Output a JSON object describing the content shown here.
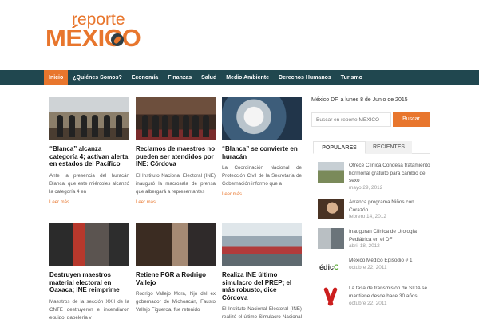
{
  "logo": {
    "top": "reporte",
    "main": "MÉXICO"
  },
  "nav": {
    "items": [
      {
        "label": "Inicio",
        "active": true
      },
      {
        "label": "¿Quiénes Somos?"
      },
      {
        "label": "Economía"
      },
      {
        "label": "Finanzas"
      },
      {
        "label": "Salud"
      },
      {
        "label": "Medio Ambiente"
      },
      {
        "label": "Derechos Humanos"
      },
      {
        "label": "Turismo"
      }
    ]
  },
  "articles": [
    {
      "title": "“Blanca” alcanza categoría 4; activan alerta en estados del Pacífico",
      "excerpt": "Ante la presencia del huracán Blanca, que este miércoles alcanzó la categoría 4 en",
      "more": "Leer más"
    },
    {
      "title": "Reclamos de maestros no pueden ser atendidos por INE: Córdova",
      "excerpt": "El Instituto Nacional Electoral (INE) inauguró la macrosala de prensa que albergará a representantes",
      "more": "Leer más"
    },
    {
      "title": "“Blanca” se convierte en huracán",
      "excerpt": "La Coordinación Nacional de Protección Civil de la Secretaría de Gobernación informó que a",
      "more": "Leer más"
    },
    {
      "title": "Destruyen maestros material electoral en Oaxaca; INE reimprime",
      "excerpt": "Maestros de la sección XXII de la CNTE destruyeron e incendiaron equipo, papelería y"
    },
    {
      "title": "Retiene PGR a Rodrigo Vallejo",
      "excerpt": "Rodrigo Vallejo Mora, hijo del ex gobernador de Michoacán, Fausto Vallejo Figueroa, fue retenido"
    },
    {
      "title": "Realiza INE último simulacro del PREP; el más robusto, dice Córdova",
      "excerpt": "El Instituto Nacional Electoral (INE) realizó el último Simulacro Nacional del Programa de"
    }
  ],
  "sidebar": {
    "date": "México DF, a lunes 8 de Junio de 2015",
    "search_placeholder": "Buscar en reporte MÉXICO",
    "search_button": "Buscar",
    "tabs": [
      "POPULARES",
      "RECIENTES"
    ],
    "popular": [
      {
        "title": "Ofrece Clínica Condesa tratamiento hormonal gratuito para cambio de sexo",
        "date": "mayo 29, 2012",
        "icon": "clinic-photo"
      },
      {
        "title": "Arranca programa Niños con Corazón",
        "date": "febrero 14, 2012",
        "icon": "child-photo"
      },
      {
        "title": "Inauguran Clínica de Urología Pediátrica en el DF",
        "date": "abril 18, 2012",
        "icon": "hospital-photo"
      },
      {
        "title": "México Médico Episodio # 1",
        "date": "octubre 22, 2011",
        "icon": "edic-logo"
      },
      {
        "title": "La tasa de transmisión de SIDA se mantiene desde hace 30 años",
        "date": "octubre 22, 2011",
        "icon": "red-ribbon-icon"
      }
    ]
  },
  "colors": {
    "accent": "#e8762d",
    "nav_bg": "#20474f"
  }
}
